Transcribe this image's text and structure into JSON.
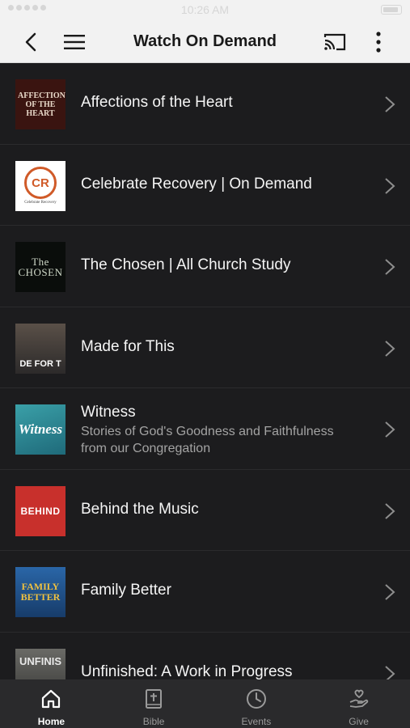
{
  "status_bar": {
    "time": "10:26 AM"
  },
  "header": {
    "title": "Watch On Demand"
  },
  "items": [
    {
      "title": "Affections of the Heart",
      "thumb_text": "AFFECTIONS OF THE HEART",
      "thumb_bg": "#3a1410",
      "thumb_fg": "#e8d8c8"
    },
    {
      "title": "Celebrate Recovery | On Demand",
      "thumb_text": "CR",
      "thumb_sub": "Celebrate Recovery",
      "thumb_bg": "#ffffff",
      "thumb_fg": "#d05a28"
    },
    {
      "title": "The Chosen | All  Church Study",
      "thumb_text": "The CHOSEN",
      "thumb_bg": "#0a0d0b",
      "thumb_fg": "#cfd8c8"
    },
    {
      "title": "Made for This",
      "thumb_text": "DE FOR T",
      "thumb_bg": "#2c2a2a",
      "thumb_fg": "#ffffff"
    },
    {
      "title": "Witness",
      "subtitle": "Stories of God's Goodness and Faithfulness from our Congregation",
      "thumb_text": "Witness",
      "thumb_bg": "#2e7f8a",
      "thumb_fg": "#ffffff"
    },
    {
      "title": "Behind the Music",
      "thumb_text": "BEHIND",
      "thumb_bg": "#c8302c",
      "thumb_fg": "#ffffff"
    },
    {
      "title": "Family Better",
      "thumb_text": "FAMILY BETTER",
      "thumb_bg": "#1f4f8a",
      "thumb_fg": "#f0c240"
    },
    {
      "title": "Unfinished: A Work in Progress",
      "thumb_text": "UNFINIS",
      "thumb_bg": "#4a4a48",
      "thumb_fg": "#e8e8e8"
    }
  ],
  "tabs": [
    {
      "label": "Home",
      "icon": "home-icon",
      "active": true
    },
    {
      "label": "Bible",
      "icon": "bible-icon",
      "active": false
    },
    {
      "label": "Events",
      "icon": "clock-icon",
      "active": false
    },
    {
      "label": "Give",
      "icon": "give-icon",
      "active": false
    }
  ]
}
